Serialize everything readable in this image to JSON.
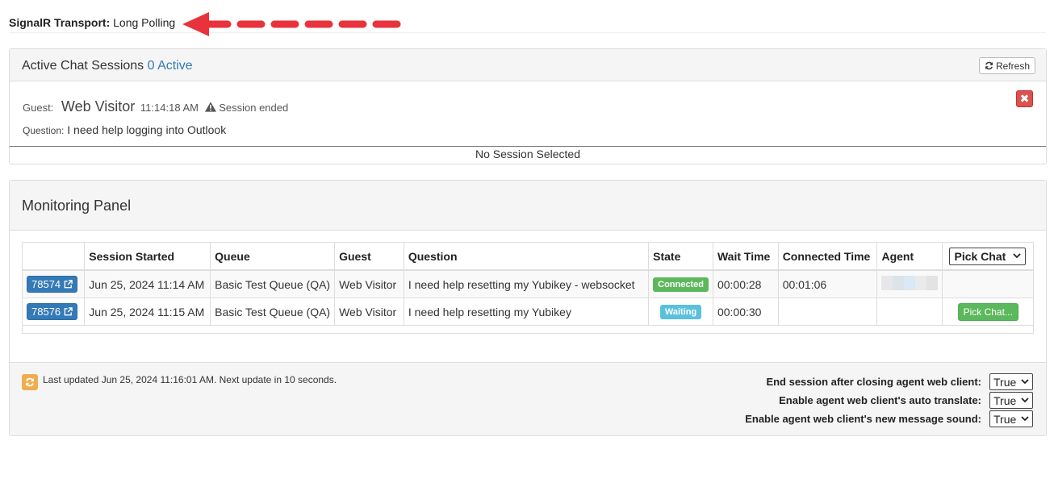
{
  "transport": {
    "label": "SignalR Transport:",
    "value": "Long Polling"
  },
  "colors": {
    "arrow": "#e8323c",
    "primary": "#337ab7",
    "success": "#5cb85c",
    "info": "#5bc0de",
    "danger": "#d9534f",
    "warning": "#f0ad4e"
  },
  "active_sessions": {
    "title": "Active Chat Sessions",
    "count_text": "0 Active",
    "refresh_label": "Refresh",
    "session": {
      "guest_label": "Guest:",
      "guest_name": "Web Visitor",
      "time": "11:14:18 AM",
      "status": "Session ended",
      "question_label": "Question:",
      "question": "I need help logging into Outlook"
    },
    "no_session_text": "No Session Selected"
  },
  "monitoring": {
    "title": "Monitoring Panel",
    "columns": [
      "Session Started",
      "Queue",
      "Guest",
      "Question",
      "State",
      "Wait Time",
      "Connected Time",
      "Agent"
    ],
    "pick_select_label": "Pick Chat",
    "rows": [
      {
        "id": "78574",
        "started": "Jun 25, 2024 11:14 AM",
        "queue": "Basic Test Queue (QA)",
        "guest": "Web Visitor",
        "question": "I need help resetting my Yubikey - websocket",
        "state": "Connected",
        "wait": "00:00:28",
        "connected": "00:01:06",
        "pick_label": ""
      },
      {
        "id": "78576",
        "started": "Jun 25, 2024 11:15 AM",
        "queue": "Basic Test Queue (QA)",
        "guest": "Web Visitor",
        "question": "I need help resetting my Yubikey",
        "state": "Waiting",
        "wait": "00:00:30",
        "connected": "",
        "pick_label": "Pick Chat..."
      }
    ],
    "last_updated": "Last updated Jun 25, 2024 11:16:01 AM. Next update in 10 seconds.",
    "settings": [
      {
        "label": "End session after closing agent web client:",
        "value": "True"
      },
      {
        "label": "Enable agent web client's auto translate:",
        "value": "True"
      },
      {
        "label": "Enable agent web client's new message sound:",
        "value": "True"
      }
    ]
  }
}
